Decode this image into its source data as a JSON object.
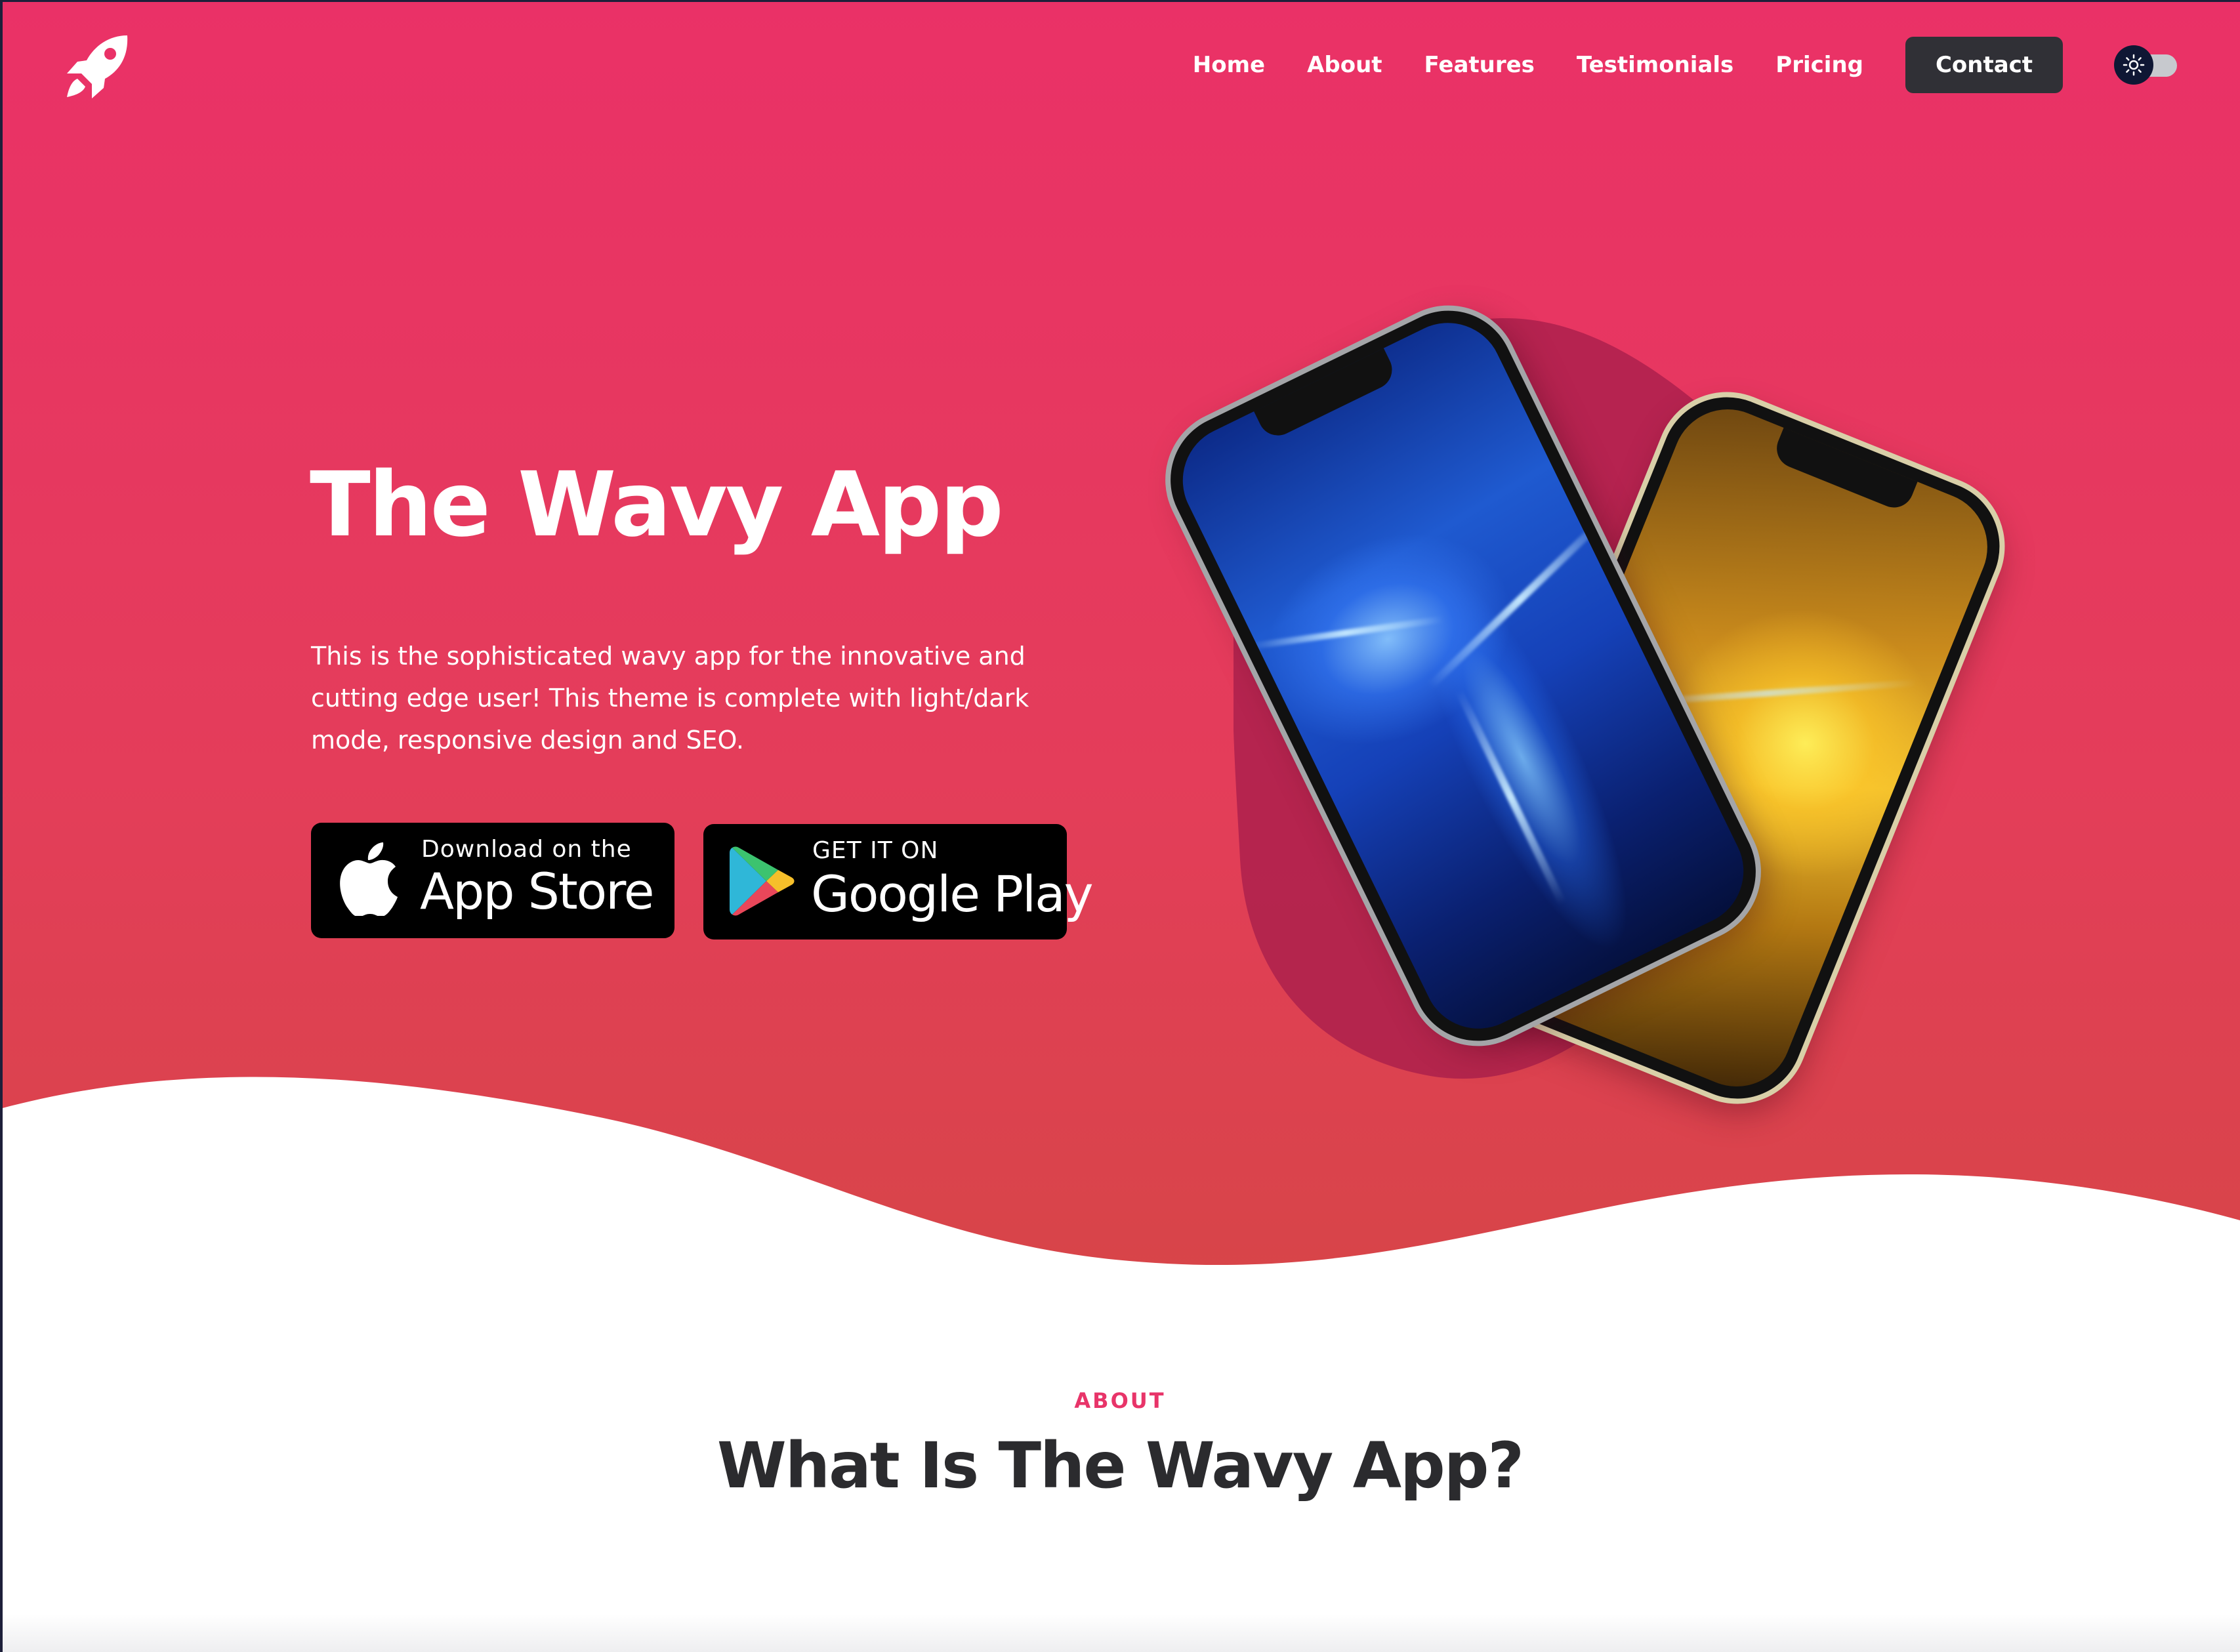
{
  "nav": {
    "links": [
      "Home",
      "About",
      "Features",
      "Testimonials",
      "Pricing"
    ],
    "contact_label": "Contact"
  },
  "icons": {
    "logo": "rocket-icon",
    "theme_toggle": "sun-icon",
    "apple_store": "apple-icon",
    "google_play": "google-play-icon"
  },
  "hero": {
    "title": "The Wavy App",
    "description": "This is the sophisticated wavy app for the innovative and cutting edge user! This theme is complete with light/dark mode, responsive design and SEO.",
    "app_store": {
      "small": "Download on the",
      "big": "App Store"
    },
    "google_play": {
      "small": "GET IT ON",
      "big": "Google Play"
    }
  },
  "about": {
    "eyebrow": "ABOUT",
    "title": "What Is The Wavy App?"
  },
  "colors": {
    "hero_top": "#ea3167",
    "hero_bottom": "#d74548",
    "blob": "#a81e4c",
    "accent": "#e83469",
    "contact_bg": "#303036",
    "heading": "#2b2b2e"
  }
}
